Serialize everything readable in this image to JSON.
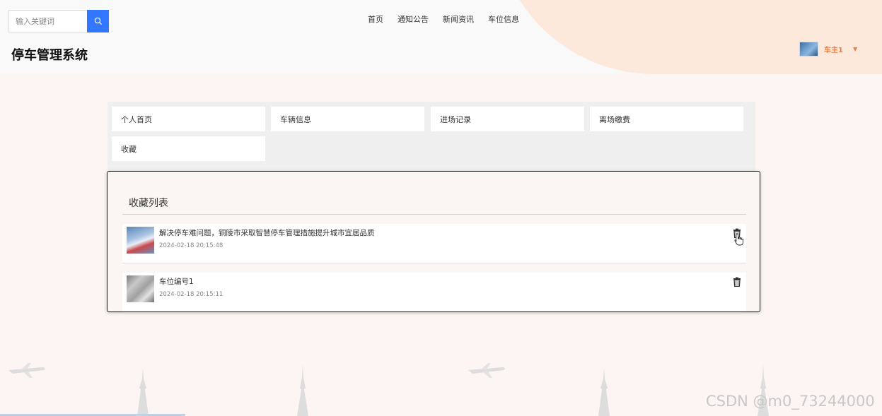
{
  "header": {
    "search": {
      "placeholder": "输入关键词"
    },
    "nav": [
      "首页",
      "通知公告",
      "新闻资讯",
      "车位信息"
    ],
    "site_title": "停车管理系统",
    "user": {
      "name": "车主1"
    }
  },
  "menu": {
    "items": [
      "个人首页",
      "车辆信息",
      "进场记录",
      "离场缴费",
      "收藏"
    ]
  },
  "favorites": {
    "title": "收藏列表",
    "items": [
      {
        "title": "解决停车难问题，铜陵市采取智慧停车管理措施提升城市宜居品质",
        "date": "2024-02-18 20:15:48",
        "thumb": "news-photo"
      },
      {
        "title": "车位编号1",
        "date": "2024-02-18 20:15:11",
        "thumb": "parking-space-photo"
      }
    ]
  },
  "watermark": "CSDN @m0_73244000",
  "colors": {
    "accent": "#3377ff",
    "user": "#e8804a"
  }
}
